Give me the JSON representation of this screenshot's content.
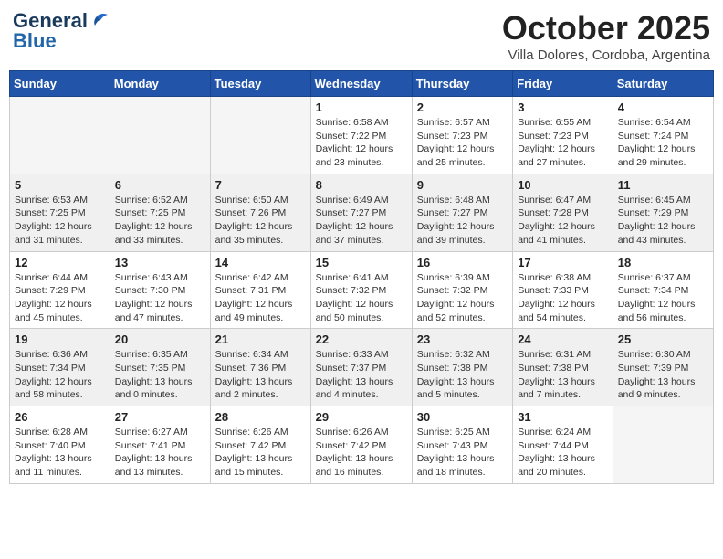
{
  "header": {
    "logo_line1": "General",
    "logo_line2": "Blue",
    "month": "October 2025",
    "location": "Villa Dolores, Cordoba, Argentina"
  },
  "weekdays": [
    "Sunday",
    "Monday",
    "Tuesday",
    "Wednesday",
    "Thursday",
    "Friday",
    "Saturday"
  ],
  "weeks": [
    [
      {
        "day": "",
        "info": ""
      },
      {
        "day": "",
        "info": ""
      },
      {
        "day": "",
        "info": ""
      },
      {
        "day": "1",
        "info": "Sunrise: 6:58 AM\nSunset: 7:22 PM\nDaylight: 12 hours\nand 23 minutes."
      },
      {
        "day": "2",
        "info": "Sunrise: 6:57 AM\nSunset: 7:23 PM\nDaylight: 12 hours\nand 25 minutes."
      },
      {
        "day": "3",
        "info": "Sunrise: 6:55 AM\nSunset: 7:23 PM\nDaylight: 12 hours\nand 27 minutes."
      },
      {
        "day": "4",
        "info": "Sunrise: 6:54 AM\nSunset: 7:24 PM\nDaylight: 12 hours\nand 29 minutes."
      }
    ],
    [
      {
        "day": "5",
        "info": "Sunrise: 6:53 AM\nSunset: 7:25 PM\nDaylight: 12 hours\nand 31 minutes."
      },
      {
        "day": "6",
        "info": "Sunrise: 6:52 AM\nSunset: 7:25 PM\nDaylight: 12 hours\nand 33 minutes."
      },
      {
        "day": "7",
        "info": "Sunrise: 6:50 AM\nSunset: 7:26 PM\nDaylight: 12 hours\nand 35 minutes."
      },
      {
        "day": "8",
        "info": "Sunrise: 6:49 AM\nSunset: 7:27 PM\nDaylight: 12 hours\nand 37 minutes."
      },
      {
        "day": "9",
        "info": "Sunrise: 6:48 AM\nSunset: 7:27 PM\nDaylight: 12 hours\nand 39 minutes."
      },
      {
        "day": "10",
        "info": "Sunrise: 6:47 AM\nSunset: 7:28 PM\nDaylight: 12 hours\nand 41 minutes."
      },
      {
        "day": "11",
        "info": "Sunrise: 6:45 AM\nSunset: 7:29 PM\nDaylight: 12 hours\nand 43 minutes."
      }
    ],
    [
      {
        "day": "12",
        "info": "Sunrise: 6:44 AM\nSunset: 7:29 PM\nDaylight: 12 hours\nand 45 minutes."
      },
      {
        "day": "13",
        "info": "Sunrise: 6:43 AM\nSunset: 7:30 PM\nDaylight: 12 hours\nand 47 minutes."
      },
      {
        "day": "14",
        "info": "Sunrise: 6:42 AM\nSunset: 7:31 PM\nDaylight: 12 hours\nand 49 minutes."
      },
      {
        "day": "15",
        "info": "Sunrise: 6:41 AM\nSunset: 7:32 PM\nDaylight: 12 hours\nand 50 minutes."
      },
      {
        "day": "16",
        "info": "Sunrise: 6:39 AM\nSunset: 7:32 PM\nDaylight: 12 hours\nand 52 minutes."
      },
      {
        "day": "17",
        "info": "Sunrise: 6:38 AM\nSunset: 7:33 PM\nDaylight: 12 hours\nand 54 minutes."
      },
      {
        "day": "18",
        "info": "Sunrise: 6:37 AM\nSunset: 7:34 PM\nDaylight: 12 hours\nand 56 minutes."
      }
    ],
    [
      {
        "day": "19",
        "info": "Sunrise: 6:36 AM\nSunset: 7:34 PM\nDaylight: 12 hours\nand 58 minutes."
      },
      {
        "day": "20",
        "info": "Sunrise: 6:35 AM\nSunset: 7:35 PM\nDaylight: 13 hours\nand 0 minutes."
      },
      {
        "day": "21",
        "info": "Sunrise: 6:34 AM\nSunset: 7:36 PM\nDaylight: 13 hours\nand 2 minutes."
      },
      {
        "day": "22",
        "info": "Sunrise: 6:33 AM\nSunset: 7:37 PM\nDaylight: 13 hours\nand 4 minutes."
      },
      {
        "day": "23",
        "info": "Sunrise: 6:32 AM\nSunset: 7:38 PM\nDaylight: 13 hours\nand 5 minutes."
      },
      {
        "day": "24",
        "info": "Sunrise: 6:31 AM\nSunset: 7:38 PM\nDaylight: 13 hours\nand 7 minutes."
      },
      {
        "day": "25",
        "info": "Sunrise: 6:30 AM\nSunset: 7:39 PM\nDaylight: 13 hours\nand 9 minutes."
      }
    ],
    [
      {
        "day": "26",
        "info": "Sunrise: 6:28 AM\nSunset: 7:40 PM\nDaylight: 13 hours\nand 11 minutes."
      },
      {
        "day": "27",
        "info": "Sunrise: 6:27 AM\nSunset: 7:41 PM\nDaylight: 13 hours\nand 13 minutes."
      },
      {
        "day": "28",
        "info": "Sunrise: 6:26 AM\nSunset: 7:42 PM\nDaylight: 13 hours\nand 15 minutes."
      },
      {
        "day": "29",
        "info": "Sunrise: 6:26 AM\nSunset: 7:42 PM\nDaylight: 13 hours\nand 16 minutes."
      },
      {
        "day": "30",
        "info": "Sunrise: 6:25 AM\nSunset: 7:43 PM\nDaylight: 13 hours\nand 18 minutes."
      },
      {
        "day": "31",
        "info": "Sunrise: 6:24 AM\nSunset: 7:44 PM\nDaylight: 13 hours\nand 20 minutes."
      },
      {
        "day": "",
        "info": ""
      }
    ]
  ]
}
